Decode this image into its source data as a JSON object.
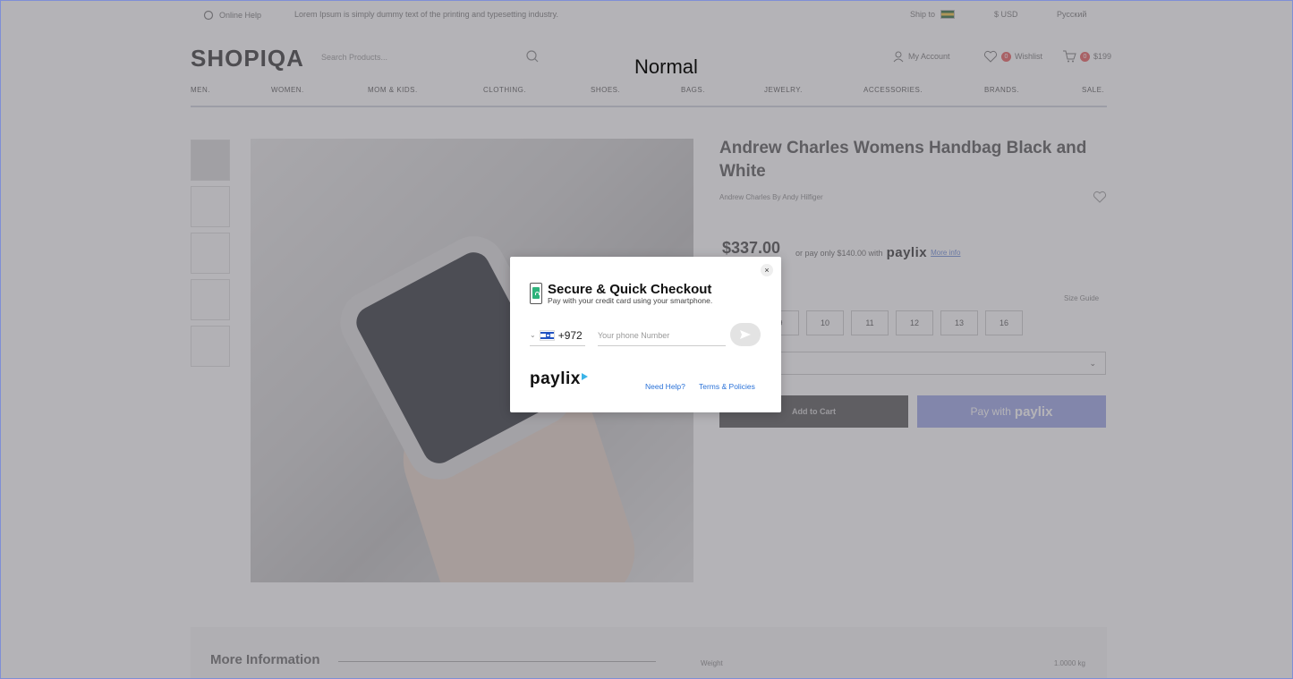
{
  "topbar": {
    "online_help": "Online Help",
    "message": "Lorem Ipsum is simply dummy text of the printing and typesetting industry.",
    "ship_to": "Ship to",
    "currency": "$ USD",
    "language": "Русский"
  },
  "header": {
    "logo": "SHOPIQA",
    "search_placeholder": "Search Products...",
    "overlay_label": "Normal",
    "my_account": "My Account",
    "wishlist": "Wishlist",
    "wishlist_count": "0",
    "cart_total": "$199",
    "cart_count": "0"
  },
  "nav": [
    "MEN.",
    "WOMEN.",
    "MOM & KIDS.",
    "CLOTHING.",
    "SHOES.",
    "BAGS.",
    "JEWELRY.",
    "ACCESSORIES.",
    "BRANDS.",
    "SALE."
  ],
  "product": {
    "title": "Andrew Charles Womens Handbag Black and White",
    "brand": "Andrew Charles By Andy Hilfiger",
    "price": "$337.00",
    "or_pay_text": "or pay only $140.00 with",
    "paylix_word": "paylix",
    "more_info_link": "More info",
    "size_guide": "Size Guide",
    "sizes": [
      "9",
      "10",
      "11",
      "12",
      "13",
      "16"
    ],
    "add_to_cart": "Add to Cart",
    "pay_with": "Pay with",
    "pay_with_brand": "paylix"
  },
  "more_info": {
    "title": "More Information",
    "weight_label": "Weight",
    "weight_value": "1.0000 kg"
  },
  "modal": {
    "title": "Secure & Quick Checkout",
    "subtitle": "Pay with your credit card using your smartphone.",
    "country_code": "+972",
    "phone_placeholder": "Your phone Number",
    "brand": "paylix",
    "need_help": "Need Help?",
    "terms": "Terms & Policies",
    "close": "×"
  },
  "colors": {
    "overlay": "#696770",
    "link": "#2a72d8",
    "lock_green": "#2fb37c",
    "paylix_accent": "#3bb4e8"
  }
}
